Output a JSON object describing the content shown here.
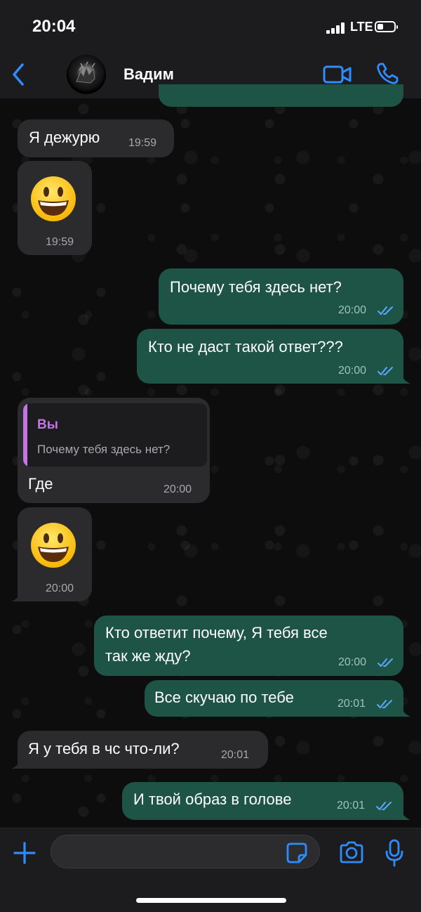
{
  "status_bar": {
    "time": "20:04",
    "network": "LTE"
  },
  "header": {
    "contact_name": "Вадим"
  },
  "colors": {
    "accent": "#2f8cff",
    "bubble_in": "#2b2b2d",
    "bubble_out": "#1e5445",
    "quote_accent": "#c574e6"
  },
  "messages": [
    {
      "dir": "in",
      "text": "Я дежурю",
      "time": "19:59"
    },
    {
      "dir": "in",
      "emoji": "smiling-face-icon",
      "time": "19:59"
    },
    {
      "dir": "out",
      "text": "Почему тебя здесь нет?",
      "time": "20:00",
      "status": "read"
    },
    {
      "dir": "out",
      "text": "Кто не даст такой ответ???",
      "time": "20:00",
      "status": "read"
    },
    {
      "dir": "in",
      "reply_to": {
        "author": "Вы",
        "text": "Почему тебя здесь нет?"
      },
      "text": "Где",
      "time": "20:00"
    },
    {
      "dir": "in",
      "emoji": "smiling-face-icon",
      "time": "20:00"
    },
    {
      "dir": "out",
      "text_lines": [
        "Кто ответит почему, Я тебя все",
        "так же жду?"
      ],
      "time": "20:00",
      "status": "read"
    },
    {
      "dir": "out",
      "text": "Все скучаю по тебе",
      "time": "20:01",
      "status": "read"
    },
    {
      "dir": "in",
      "text": "Я у тебя в чс что-ли?",
      "time": "20:01"
    },
    {
      "dir": "out",
      "text": "И твой образ в голове",
      "time": "20:01",
      "status": "read"
    }
  ],
  "input": {
    "placeholder": ""
  }
}
